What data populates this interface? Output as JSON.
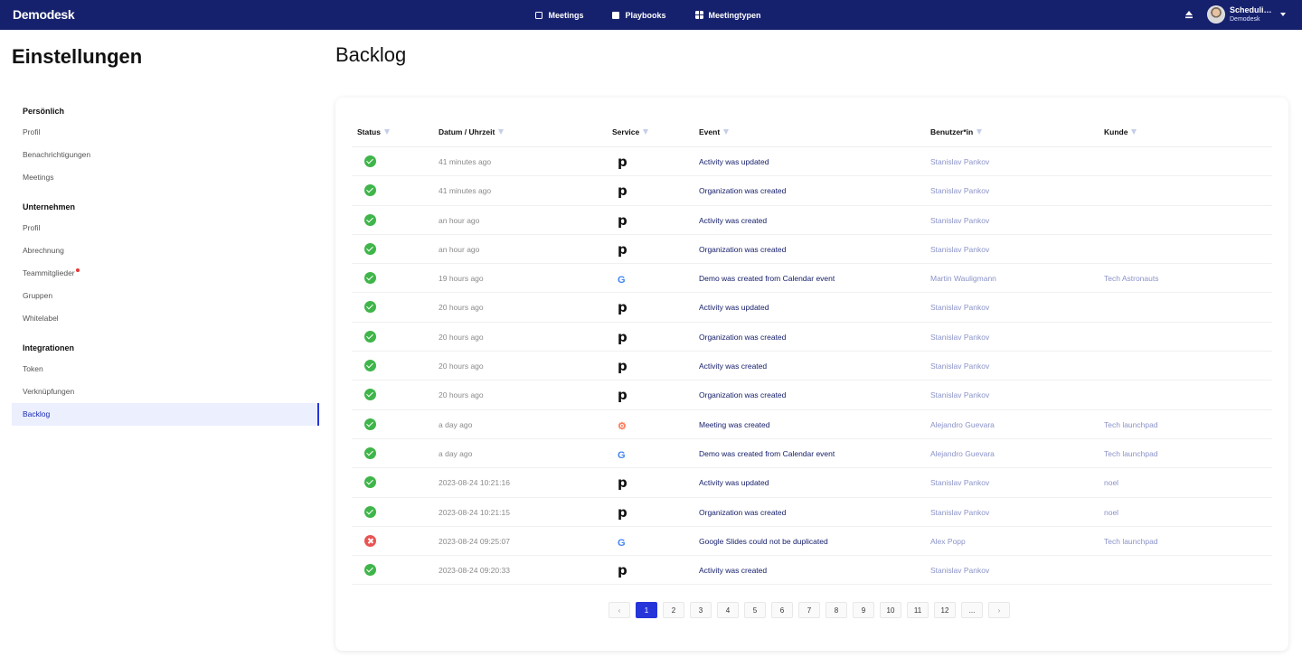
{
  "topbar": {
    "logo": "Demodesk",
    "nav": [
      {
        "label": "Meetings",
        "icon": "calendar-icon"
      },
      {
        "label": "Playbooks",
        "icon": "playbook-icon"
      },
      {
        "label": "Meetingtypen",
        "icon": "grid-icon"
      }
    ],
    "user": {
      "name": "Schedulin...",
      "org": "Demodesk"
    }
  },
  "sidebar": {
    "title": "Einstellungen",
    "sections": [
      {
        "title": "Persönlich",
        "items": [
          "Profil",
          "Benachrichtigungen",
          "Meetings"
        ]
      },
      {
        "title": "Unternehmen",
        "items": [
          "Profil",
          "Abrechnung",
          "Teammitglieder",
          "Gruppen",
          "Whitelabel"
        ]
      },
      {
        "title": "Integrationen",
        "items": [
          "Token",
          "Verknüpfungen",
          "Backlog"
        ]
      }
    ],
    "active": "Backlog"
  },
  "main": {
    "title": "Backlog",
    "columns": [
      "Status",
      "Datum / Uhrzeit",
      "Service",
      "Event",
      "Benutzer*in",
      "Kunde"
    ],
    "rows": [
      {
        "status": "ok",
        "date": "41 minutes ago",
        "service": "pipedrive",
        "event": "Activity was updated",
        "user": "Stanislav Pankov",
        "kunde": ""
      },
      {
        "status": "ok",
        "date": "41 minutes ago",
        "service": "pipedrive",
        "event": "Organization was created",
        "user": "Stanislav Pankov",
        "kunde": ""
      },
      {
        "status": "ok",
        "date": "an hour ago",
        "service": "pipedrive",
        "event": "Activity was created",
        "user": "Stanislav Pankov",
        "kunde": ""
      },
      {
        "status": "ok",
        "date": "an hour ago",
        "service": "pipedrive",
        "event": "Organization was created",
        "user": "Stanislav Pankov",
        "kunde": ""
      },
      {
        "status": "ok",
        "date": "19 hours ago",
        "service": "google",
        "event": "Demo was created from Calendar event",
        "user": "Martin Wauligmann",
        "kunde": "Tech Astronauts"
      },
      {
        "status": "ok",
        "date": "20 hours ago",
        "service": "pipedrive",
        "event": "Activity was updated",
        "user": "Stanislav Pankov",
        "kunde": ""
      },
      {
        "status": "ok",
        "date": "20 hours ago",
        "service": "pipedrive",
        "event": "Organization was created",
        "user": "Stanislav Pankov",
        "kunde": ""
      },
      {
        "status": "ok",
        "date": "20 hours ago",
        "service": "pipedrive",
        "event": "Activity was created",
        "user": "Stanislav Pankov",
        "kunde": ""
      },
      {
        "status": "ok",
        "date": "20 hours ago",
        "service": "pipedrive",
        "event": "Organization was created",
        "user": "Stanislav Pankov",
        "kunde": ""
      },
      {
        "status": "ok",
        "date": "a day ago",
        "service": "hubspot",
        "event": "Meeting was created",
        "user": "Alejandro Guevara",
        "kunde": "Tech launchpad"
      },
      {
        "status": "ok",
        "date": "a day ago",
        "service": "google",
        "event": "Demo was created from Calendar event",
        "user": "Alejandro Guevara",
        "kunde": "Tech launchpad"
      },
      {
        "status": "ok",
        "date": "2023-08-24 10:21:16",
        "service": "pipedrive",
        "event": "Activity was updated",
        "user": "Stanislav Pankov",
        "kunde": "noel"
      },
      {
        "status": "ok",
        "date": "2023-08-24 10:21:15",
        "service": "pipedrive",
        "event": "Organization was created",
        "user": "Stanislav Pankov",
        "kunde": "noel"
      },
      {
        "status": "error",
        "date": "2023-08-24 09:25:07",
        "service": "google",
        "event": "Google Slides could not be duplicated",
        "user": "Alex Popp",
        "kunde": "Tech launchpad"
      },
      {
        "status": "ok",
        "date": "2023-08-24 09:20:33",
        "service": "pipedrive",
        "event": "Activity was created",
        "user": "Stanislav Pankov",
        "kunde": ""
      }
    ],
    "pagination": {
      "prev": "‹",
      "pages": [
        "1",
        "2",
        "3",
        "4",
        "5",
        "6",
        "7",
        "8",
        "9",
        "10",
        "11",
        "12",
        "..."
      ],
      "next": "›",
      "current": "1"
    }
  },
  "colors": {
    "topbar": "#16216e",
    "accent": "#2535d9",
    "success": "#3fb54a",
    "error": "#e85454"
  }
}
